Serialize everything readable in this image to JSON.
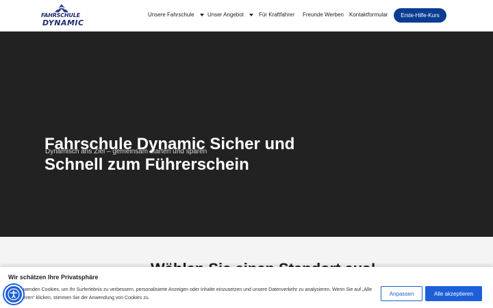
{
  "header": {
    "logo": {
      "line1": "FAHRSCHULE",
      "line2": "DYNAMIC",
      "icon": "logo-icon"
    },
    "nav": [
      {
        "label": "Unsere Fahrschule",
        "has_dropdown": true
      },
      {
        "label": "Unser Angebot",
        "has_dropdown": true
      },
      {
        "label": "Für Kraftfahrer",
        "has_dropdown": false
      },
      {
        "label": "Freunde Werben",
        "has_dropdown": false
      },
      {
        "label": "Kontaktformular",
        "has_dropdown": false
      }
    ],
    "cta_label": "Erste-Hilfe-Kurs"
  },
  "hero": {
    "subtitle": "Dynamisch ans Ziel – gemeinsam starten und sparen",
    "title": "Fahrschule Dynamic Sicher und Schnell zum Führerschein"
  },
  "section": {
    "title": "Wählen Sie einen Standort aus!"
  },
  "cookie": {
    "title": "Wir schätzen Ihre Privatsphäre",
    "text": "Wir verwenden Cookies, um Ihr Surferlebnis zu verbessern, personalisierte Anzeigen oder Inhalte einzusetzen und unsere Datenverkehr zu analysieren. Wenn Sie auf „Alle akzeptieren“ klicken, stimmen Sie der Anwendung von Cookies zu.",
    "customize_label": "Anpassen",
    "accept_label": "Alle akzeptieren"
  },
  "colors": {
    "brand": "#1d2b6e",
    "cta": "#0a3d91",
    "accent": "#1d5fd9",
    "hero_bg": "#222222"
  },
  "accessibility": {
    "icon": "accessibility-icon"
  }
}
